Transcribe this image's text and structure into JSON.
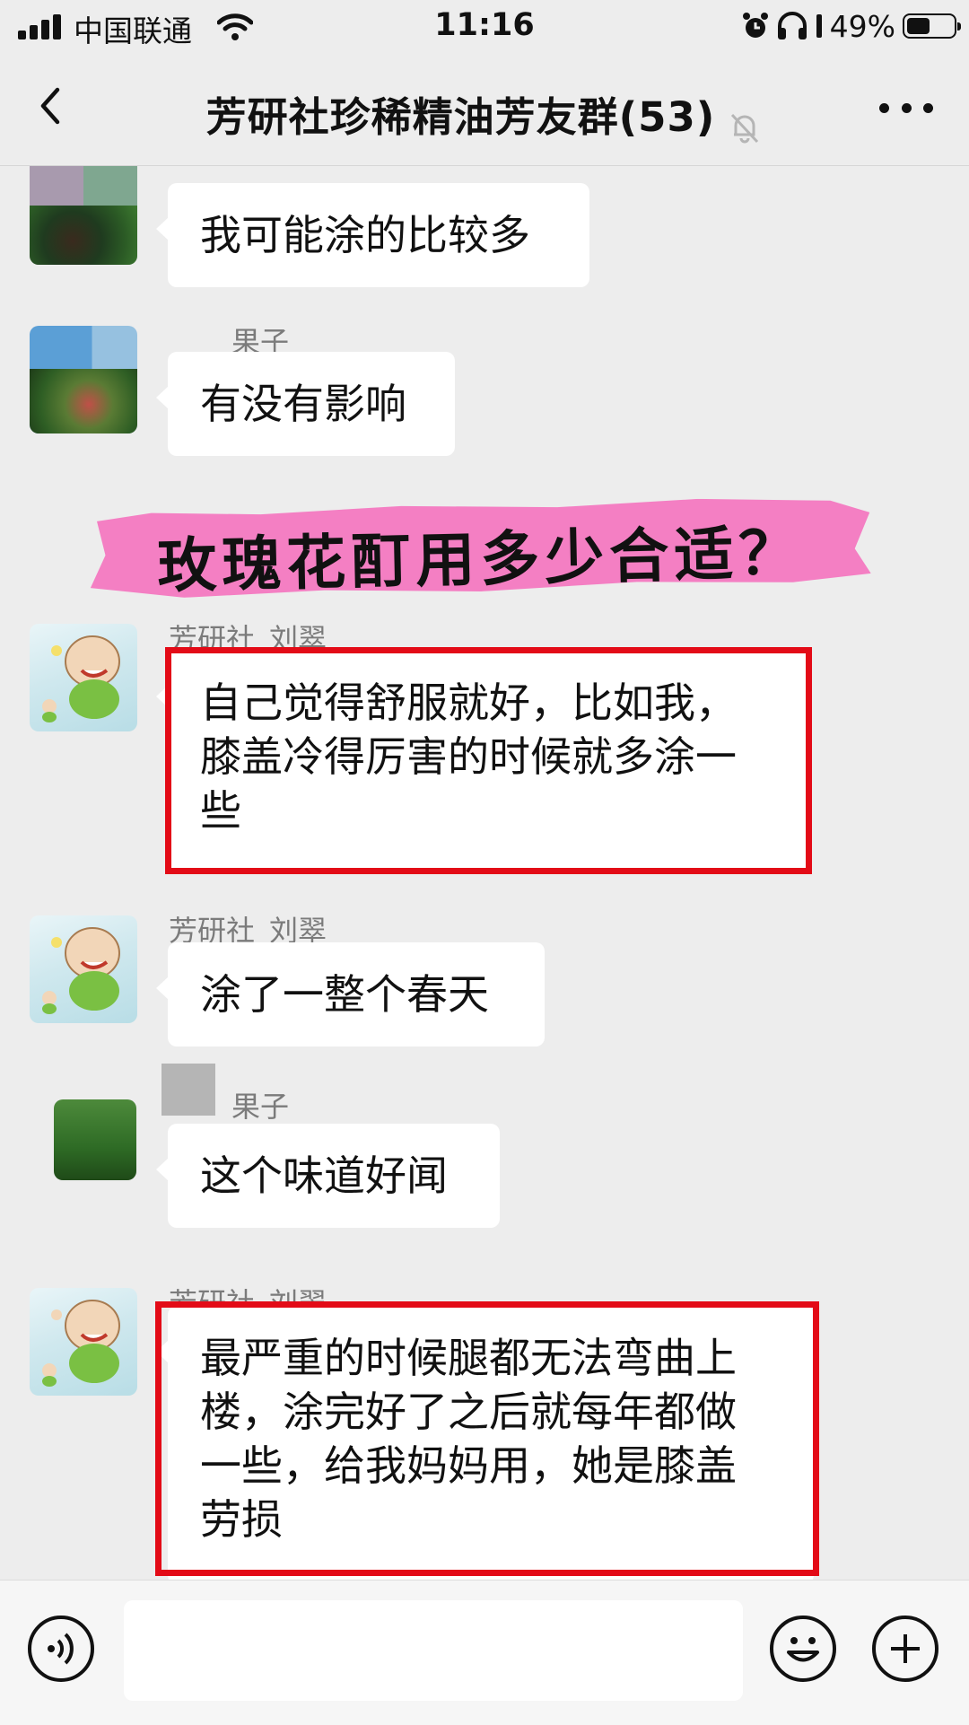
{
  "status_bar": {
    "carrier": "中国联通",
    "time": "11:16",
    "battery_percent": "49%",
    "battery_level": 0.49,
    "icons": [
      "signal-icon",
      "wifi-icon",
      "alarm-icon",
      "headphones-icon",
      "battery-icon"
    ]
  },
  "header": {
    "title": "芳研社珍稀精油芳友群(53)",
    "icons": [
      "back-icon",
      "mute-bell-icon",
      "more-icon"
    ]
  },
  "banner": {
    "text": "玫瑰花酊用多少合适？",
    "color": "#f47fc3"
  },
  "messages": [
    {
      "sender": "",
      "text": "我可能涂的比较多",
      "avatar": "blurred-photo"
    },
    {
      "sender": "果子",
      "text": "有没有影响",
      "avatar": "blurred-photo"
    },
    {
      "sender": "芳研社_刘翠",
      "text": "自己觉得舒服就好，比如我，\n膝盖冷得厉害的时候就多涂一\n些",
      "avatar": "cartoon-fairy",
      "highlighted": true
    },
    {
      "sender": "芳研社_刘翠",
      "text": "涂了一整个春天",
      "avatar": "cartoon-fairy"
    },
    {
      "sender": "果子",
      "text": "这个味道好闻",
      "avatar": "blurred-photo"
    },
    {
      "sender": "芳研社_刘翠",
      "text": "最严重的时候腿都无法弯曲上\n楼，涂完好了之后就每年都做\n一些，给我妈妈用，她是膝盖\n劳损",
      "avatar": "cartoon-fairy",
      "highlighted": true
    }
  ],
  "input_bar": {
    "placeholder": "",
    "icons": [
      "voice-icon",
      "emoji-icon",
      "plus-icon"
    ]
  },
  "colors": {
    "background": "#ededed",
    "bubble": "#ffffff",
    "highlight_border": "#e30b17",
    "sender_name": "#7b7b7b"
  }
}
